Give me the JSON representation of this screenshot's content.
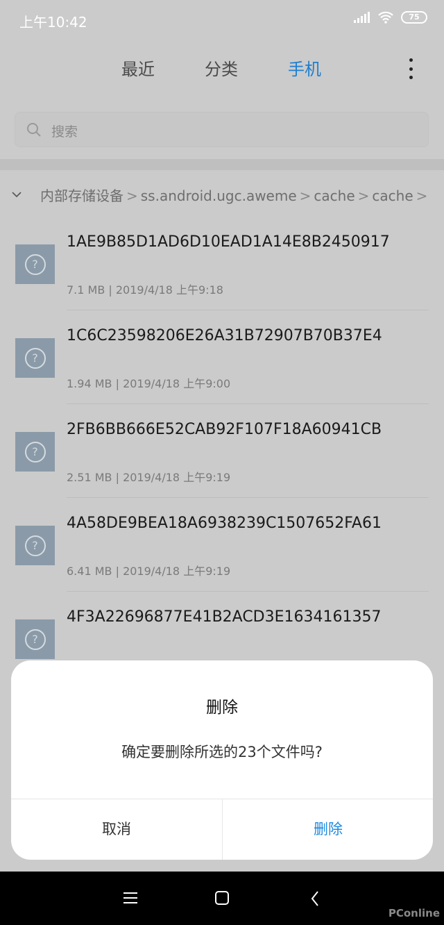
{
  "status_bar": {
    "time": "上午10:42",
    "battery": "75"
  },
  "tabs": [
    {
      "label": "最近"
    },
    {
      "label": "分类"
    },
    {
      "label": "手机",
      "active": true
    }
  ],
  "search": {
    "placeholder": "搜索"
  },
  "breadcrumb": [
    "内部存储设备",
    "ss.android.ugc.aweme",
    "cache",
    "cache"
  ],
  "files": [
    {
      "name": "1AE9B85D1AD6D10EAD1A14E8B2450917",
      "size": "7.1 MB",
      "date": "2019/4/18 上午9:18"
    },
    {
      "name": "1C6C23598206E26A31B72907B70B37E4",
      "size": "1.94 MB",
      "date": "2019/4/18 上午9:00"
    },
    {
      "name": "2FB6BB666E52CAB92F107F18A60941CB",
      "size": "2.51 MB",
      "date": "2019/4/18 上午9:19"
    },
    {
      "name": "4A58DE9BEA18A6938239C1507652FA61",
      "size": "6.41 MB",
      "date": "2019/4/18 上午9:19"
    },
    {
      "name": "4F3A22696877E41B2ACD3E1634161357",
      "size": "",
      "date": ""
    }
  ],
  "dialog": {
    "title": "删除",
    "message": "确定要删除所选的23个文件吗?",
    "cancel": "取消",
    "confirm": "删除"
  },
  "colors": {
    "accent": "#1d8ae0",
    "nav_bar": "#000000"
  },
  "watermark": "PConline"
}
